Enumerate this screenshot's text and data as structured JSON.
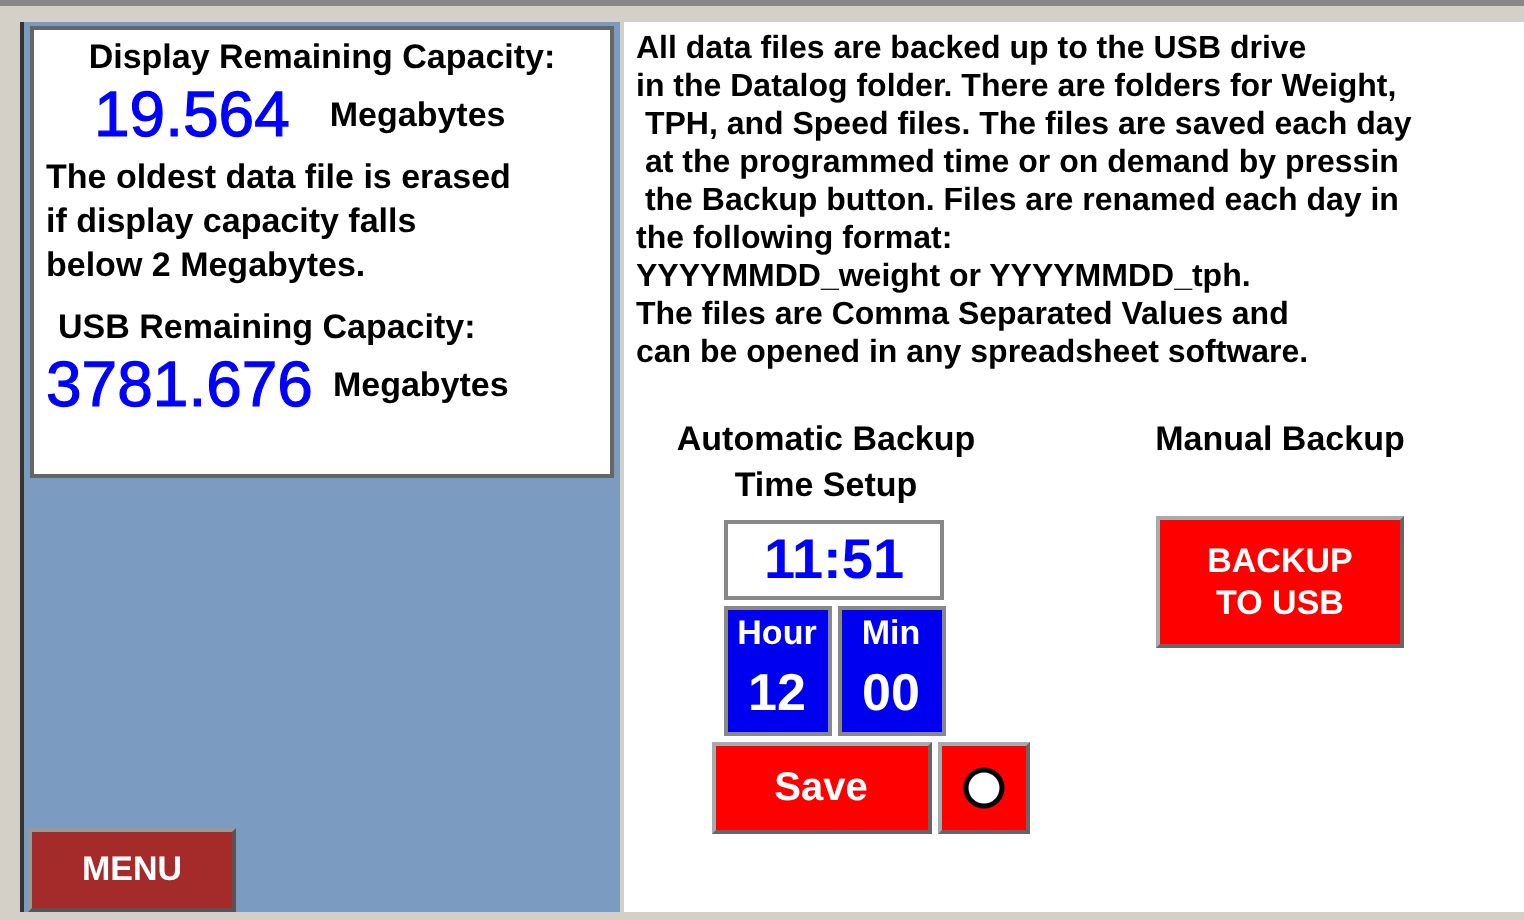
{
  "capacity": {
    "display_label": "Display Remaining Capacity:",
    "display_value": "19.564",
    "display_unit": "Megabytes",
    "note": [
      "The oldest data file is erased",
      "if display capacity falls",
      "below 2 Megabytes."
    ],
    "usb_label": "USB Remaining Capacity:",
    "usb_value": "3781.676",
    "usb_unit": "Megabytes"
  },
  "menu_button": "MENU",
  "info": [
    "All data files are backed up to the USB drive",
    "in the Datalog folder. There are folders for Weight,",
    " TPH, and Speed files. The files are saved each day",
    " at the programmed time or on demand by pressin",
    " the Backup button. Files are renamed each day in",
    "the following format:",
    "YYYYMMDD_weight or YYYYMMDD_tph.",
    "The files are Comma Separated Values and",
    "can be opened in any spreadsheet software."
  ],
  "auto_backup": {
    "title": [
      "Automatic Backup",
      "Time Setup"
    ],
    "time": "11:51",
    "hour_label": "Hour",
    "hour": "12",
    "min_label": "Min",
    "min": "00",
    "save": "Save"
  },
  "manual_backup": {
    "title": "Manual Backup",
    "button": [
      "BACKUP",
      "TO USB"
    ]
  }
}
